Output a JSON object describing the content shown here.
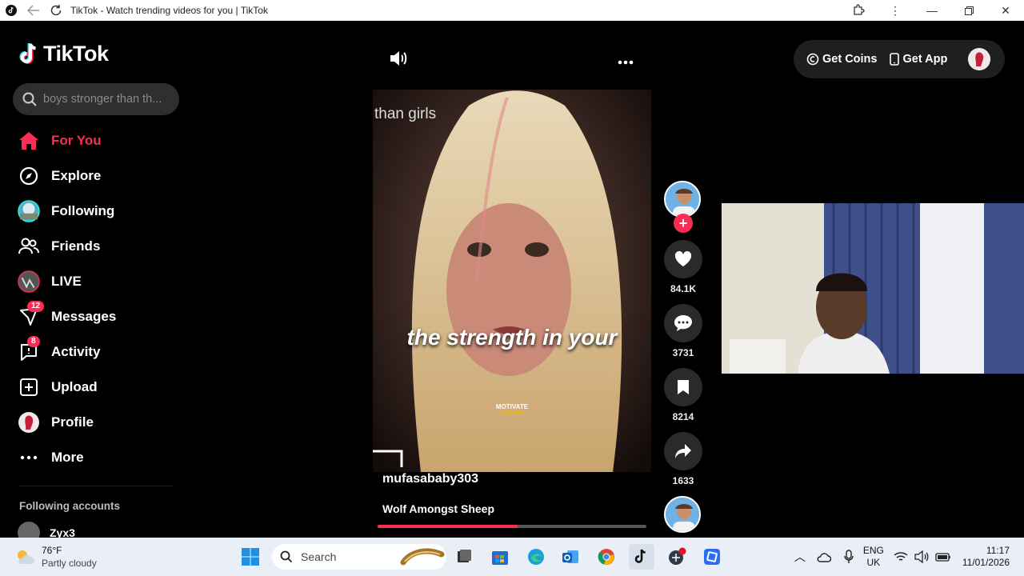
{
  "browser": {
    "title": "TikTok - Watch trending videos for you | TikTok"
  },
  "sidebar": {
    "logo_text": "TikTok",
    "search_placeholder": "boys stronger than th...",
    "items": [
      {
        "label": "For You",
        "icon": "home-icon",
        "active": true
      },
      {
        "label": "Explore",
        "icon": "compass-icon"
      },
      {
        "label": "Following",
        "icon": "following-avatar-icon"
      },
      {
        "label": "Friends",
        "icon": "friends-icon"
      },
      {
        "label": "LIVE",
        "icon": "live-avatar-icon"
      },
      {
        "label": "Messages",
        "icon": "messages-icon",
        "badge": "12"
      },
      {
        "label": "Activity",
        "icon": "activity-icon",
        "badge": "8"
      },
      {
        "label": "Upload",
        "icon": "upload-icon"
      },
      {
        "label": "Profile",
        "icon": "profile-avatar-icon"
      },
      {
        "label": "More",
        "icon": "more-dots-icon"
      }
    ],
    "following_title": "Following accounts",
    "following_accounts": [
      "Zyx3"
    ]
  },
  "header": {
    "get_coins": "Get Coins",
    "get_app": "Get App"
  },
  "video": {
    "overlay_title": "than girls",
    "caption": "the strength in your",
    "watermark_top": "MOTIVATE",
    "watermark_bottom": "MENTOR!",
    "author": "mufasababy303",
    "description": "Wolf Amongst Sheep",
    "progress": 0.52
  },
  "actions": {
    "likes": "84.1K",
    "comments": "3731",
    "saves": "8214",
    "shares": "1633"
  },
  "taskbar": {
    "weather_temp": "76°F",
    "weather_desc": "Partly cloudy",
    "search_label": "Search",
    "lang_top": "ENG",
    "lang_bottom": "UK",
    "time": "11:17",
    "date": "11/01/2026"
  },
  "colors": {
    "accent": "#fe2c55",
    "background": "#000000",
    "taskbar": "#e9eef7"
  }
}
